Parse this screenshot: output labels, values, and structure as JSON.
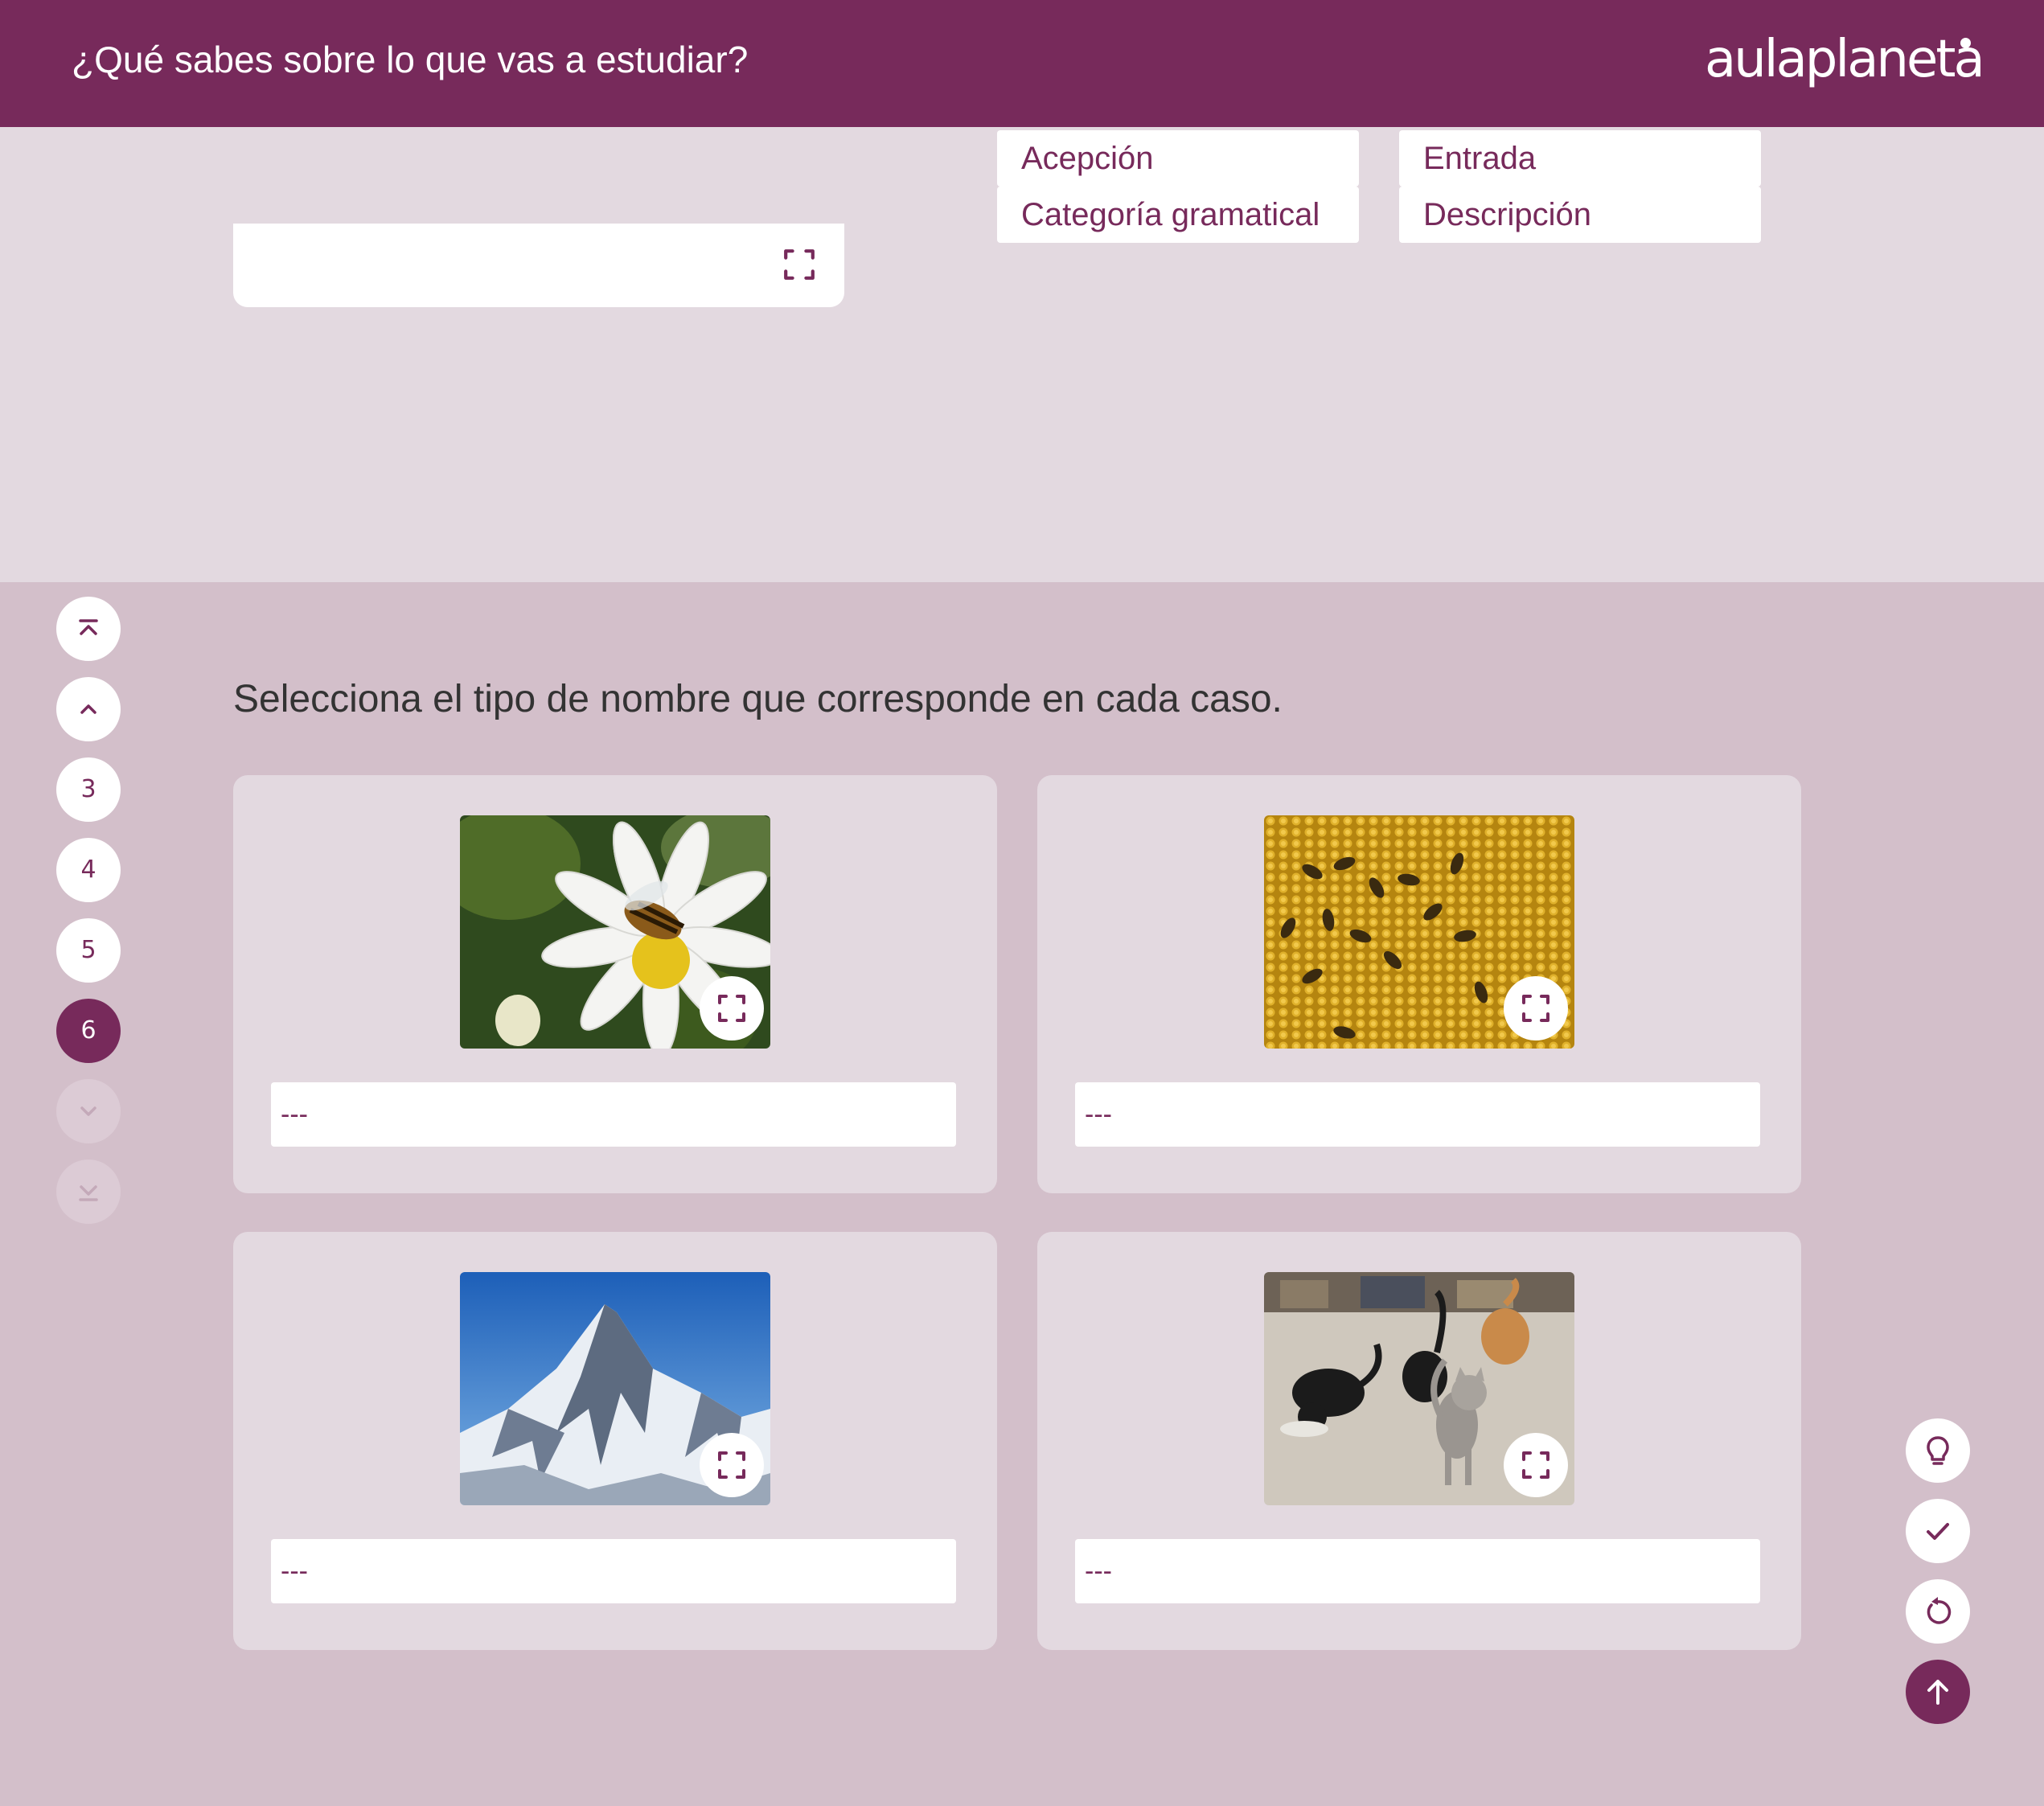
{
  "header": {
    "title": "¿Qué sabes sobre lo que vas a estudiar?",
    "logo": "aulaplaneta"
  },
  "previous_exercise": {
    "chips": [
      "Acepción",
      "Entrada",
      "Categoría gramatical",
      "Descripción"
    ],
    "expand_icon": "expand-icon"
  },
  "side_nav": {
    "first_icon": "chevrons-up-to-top-icon",
    "prev_icon": "chevron-up-icon",
    "pages": [
      "3",
      "4",
      "5",
      "6"
    ],
    "current_page": "6",
    "next_icon": "chevron-down-icon",
    "last_icon": "chevrons-down-to-bottom-icon"
  },
  "exercise": {
    "question": "Selecciona el tipo de nombre que corresponde en cada caso.",
    "cards": [
      {
        "image": "bee-on-daisy-photo",
        "select_value": "---"
      },
      {
        "image": "bees-on-honeycomb-photo",
        "select_value": "---"
      },
      {
        "image": "snowy-mountain-photo",
        "select_value": "---"
      },
      {
        "image": "cats-eating-photo",
        "select_value": "---"
      }
    ]
  },
  "tools": [
    "lightbulb-icon",
    "check-icon",
    "reset-icon",
    "arrow-up-icon"
  ],
  "colors": {
    "brand": "#772a5b",
    "background": "#d3bfca",
    "panel": "#e3d9e0",
    "white": "#ffffff"
  }
}
